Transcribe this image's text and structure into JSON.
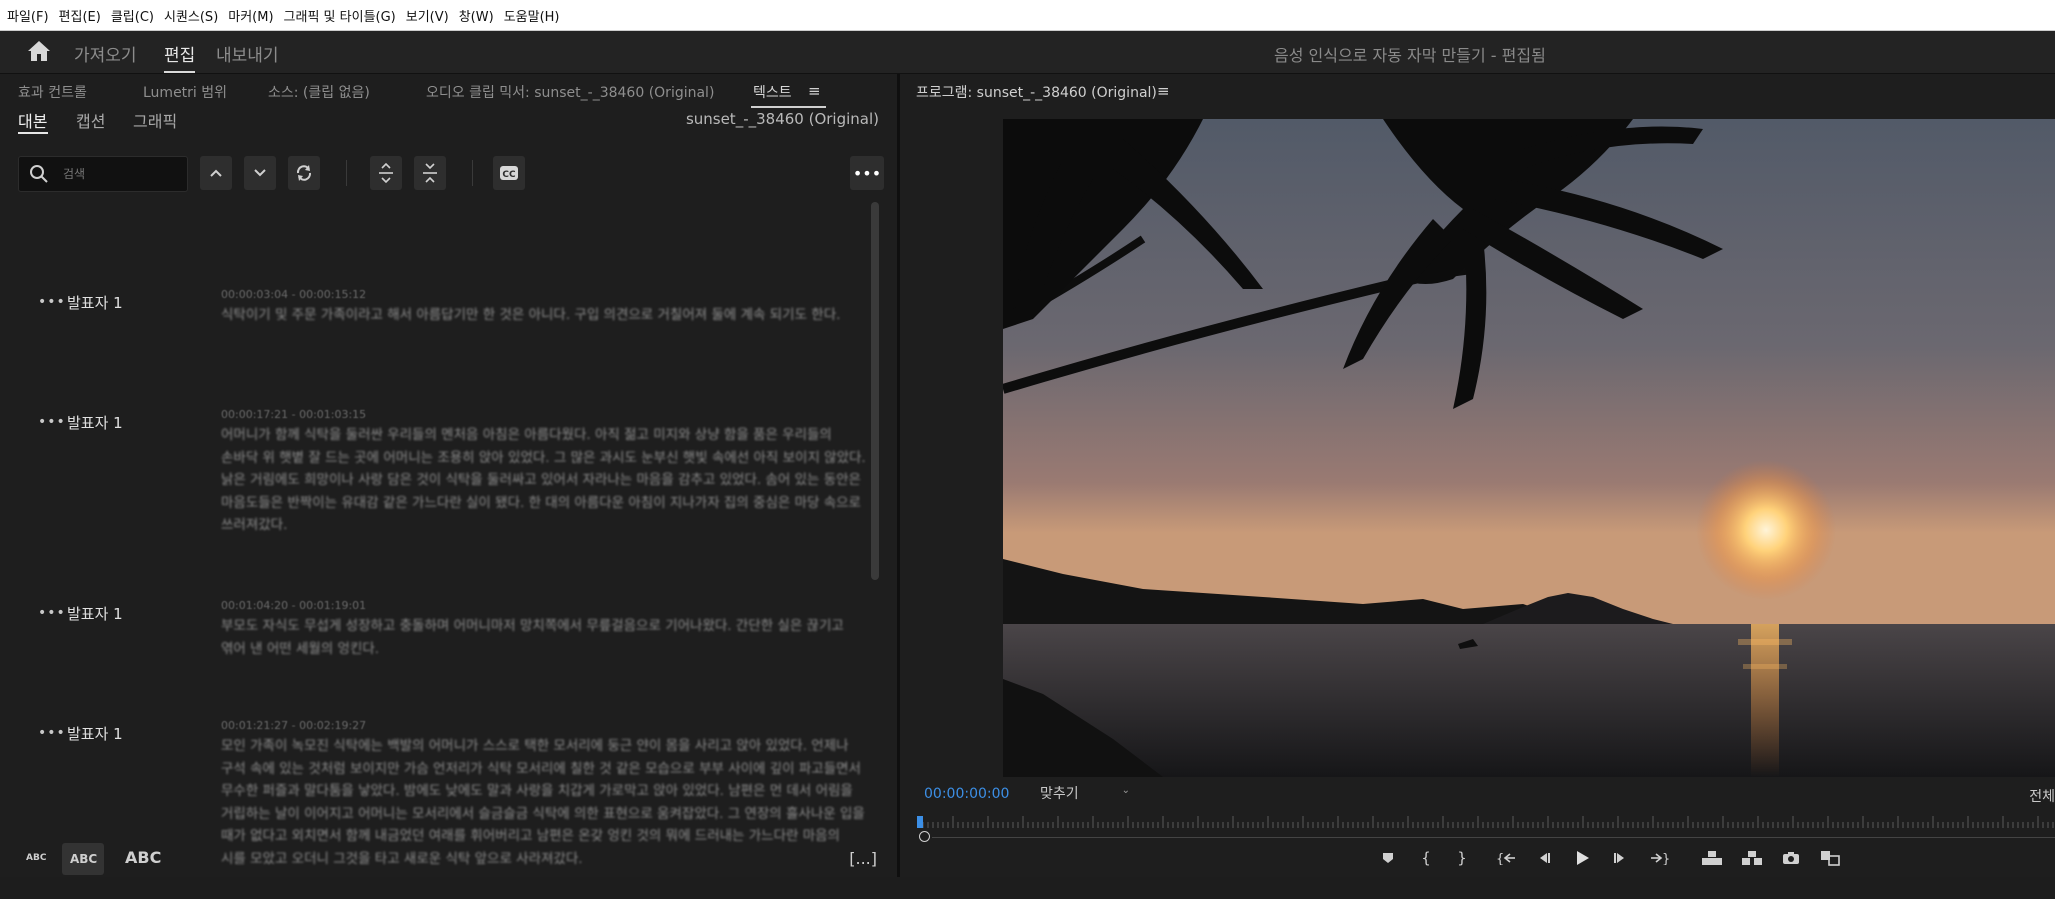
{
  "menu": [
    "파일(F)",
    "편집(E)",
    "클립(C)",
    "시퀀스(S)",
    "마커(M)",
    "그래픽 및 타이틀(G)",
    "보기(V)",
    "창(W)",
    "도움말(H)"
  ],
  "workspaces": {
    "import": "가져오기",
    "edit": "편집",
    "export": "내보내기"
  },
  "document_title": "음성 인식으로 자동 자막 만들기 - 편집됨",
  "left_panel": {
    "tabs": [
      "효과 컨트롤",
      "Lumetri 범위",
      "소스: (클립 없음)",
      "오디오 클립 믹서: sunset_-_38460 (Original)",
      "텍스트"
    ],
    "subtabs": [
      "대본",
      "캡션",
      "그래픽"
    ],
    "sequence_name": "sunset_-_38460 (Original)",
    "search_placeholder": "검색"
  },
  "transcript": [
    {
      "speaker": "발표자 1",
      "timecode": "00:00:03:04 - 00:00:15:12",
      "text": "식탁이기 및 주문 가족이라고 해서 아름답기만 한 것은 아니다. 구입 의견으로 거칠어져 둘에 계속 되기도 한다."
    },
    {
      "speaker": "발표자 1",
      "timecode": "00:00:17:21 - 00:01:03:15",
      "text": "어머니가 함께 식탁을 둘러싼 우리들의 멘처음 아침은 아름다웠다. 아직 젊고 미지와 상냥 함을 품은 우리들의 손바닥 위 햇볕 잘 드는 곳에 어머니는 조용히 앉아 있었다. 그 많은 과시도 눈부신 햇빛 속에선 아직 보이지 않았다. 낡은 거림에도 희망이나 사랑 담은 것이 식탁을 둘러싸고 있어서 자라나는 마음을 감추고 있었다. 솜어 있는 동안은 마음도들은 반짝이는 유대감 같은 가느다란 실이 됐다. 한 대의 아름다운 아침이 지나가자 집의 중심은 마당 속으로 쓰러져갔다."
    },
    {
      "speaker": "발표자 1",
      "timecode": "00:01:04:20 - 00:01:19:01",
      "text": "부모도 자식도 무섭게 성장하고 충돌하며 어머니마저 망치쪽에서 무릎걸음으로 기어나왔다. 간단한 실은 끊기고 엮어 낸 어떤 세월의 엉킨다."
    },
    {
      "speaker": "발표자 1",
      "timecode": "00:01:21:27 - 00:02:19:27",
      "text": "모인 가족이 녹모진 식탁에는 백발의 어머니가 스스로 택한 모서리에 둥근 얀이 몸을 사리고 앉아 있었다. 언제나 구석 속에 있는 것처럼 보이지만 가슴 언저리가 식탁 모서리에 칠한 것 같은 모습으로 부부 사이에 깊이 파고들면서 무수한 퍼즐과 말다툼을 낳았다. 밤에도 낮에도 말과 사랑을 치갑게 가로막고 앉아 있었다. 남편은 먼 데서 어림을 거립하는 날이 이어지고 어머니는 모서리에서 슬금슬금 식탁에 의한 표현으로 움켜잡았다. 그 연장의 흘사나운 입을 때가 없다고 외치면서 함께 내금었던 여래를 휘어버리고 남편은 온갖 엉킨 것의 뭐에 드러내는 가느다란 마음의 시를 모았고 오더니 그것을 타고 새로운 식탁 앞으로 사라져갔다."
    }
  ],
  "bottom_bar": {
    "abc_small": "ABC",
    "abc_medium": "ABC",
    "abc_large": "ABC",
    "expand": "[...]"
  },
  "program_monitor": {
    "title": "프로그램: sunset_-_38460 (Original)",
    "timecode": "00:00:00:00",
    "zoom": "맞추기",
    "resolution": "전체",
    "playhead_fraction": 0.0
  },
  "colors": {
    "accent": "#3c8fe6",
    "panel_bg": "#1e1e1e",
    "menubar_bg": "#ffffff"
  }
}
